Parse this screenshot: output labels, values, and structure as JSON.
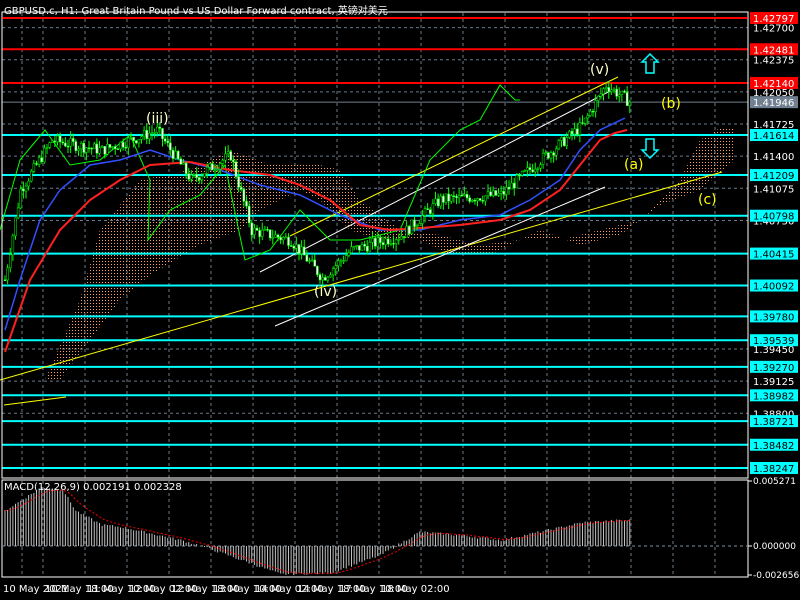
{
  "header": {
    "title": "GBPUSD.c, H1:  Great Britain Pound vs US Dollar Forward contract, 英镑对美元"
  },
  "colors": {
    "background": "#000000",
    "bull": "#00ff00",
    "red_level": "#ff0000",
    "cyan_level": "#00ffff",
    "current_price": "#708090",
    "wave_label": "#ffff00"
  },
  "chart_data": {
    "type": "candlestick",
    "symbol": "GBPUSD.c",
    "timeframe": "H1",
    "ylim": [
      1.381,
      1.429
    ],
    "current_price": "1.41946",
    "y_ticks": [
      "1.42700",
      "1.42375",
      "1.42050",
      "1.41725",
      "1.41400",
      "1.41075",
      "1.40750",
      "1.39450",
      "1.39125",
      "1.38800"
    ],
    "x_ticks": [
      "10 May 2021",
      "10 May 18:00",
      "11 May 10:00",
      "12 May 02:00",
      "12 May 18:00",
      "13 May 10:00",
      "14 May 02:00",
      "14 May 18:00",
      "17 May 10:00",
      "18 May 02:00"
    ],
    "red_levels": [
      "1.42797",
      "1.42481",
      "1.42140"
    ],
    "cyan_levels": [
      "1.41614",
      "1.41209",
      "1.40798",
      "1.40415",
      "1.40092",
      "1.39780",
      "1.39539",
      "1.39270",
      "1.38982",
      "1.38721",
      "1.38482",
      "1.38247"
    ],
    "price_path": [
      [
        0,
        1.4015
      ],
      [
        6,
        1.4106
      ],
      [
        18,
        1.4156
      ],
      [
        37,
        1.4146
      ],
      [
        58,
        1.4166
      ],
      [
        71,
        1.4116
      ],
      [
        86,
        1.4141
      ],
      [
        94,
        1.4065
      ],
      [
        109,
        1.4055
      ],
      [
        121,
        1.4017
      ],
      [
        132,
        1.4045
      ],
      [
        151,
        1.406
      ],
      [
        166,
        1.4096
      ],
      [
        189,
        1.4101
      ],
      [
        204,
        1.4136
      ],
      [
        220,
        1.4171
      ],
      [
        229,
        1.4212
      ],
      [
        238,
        1.4195
      ]
    ],
    "wave_labels": [
      "(iii)",
      "(iv)",
      "(v)",
      "(a)",
      "(b)",
      "(c)"
    ],
    "macd": {
      "label": "MACD(12,26,9) 0.002191 0.002328",
      "y_ticks": [
        "0.005271",
        "0.000000",
        "-0.002656"
      ],
      "ylim": [
        -0.002656,
        0.005271
      ],
      "histogram_path": [
        [
          0,
          0.003
        ],
        [
          14,
          0.005
        ],
        [
          22,
          0.0048
        ],
        [
          27,
          0.003
        ],
        [
          37,
          0.0018
        ],
        [
          45,
          0.0016
        ],
        [
          67,
          0.0005
        ],
        [
          75,
          0.0
        ],
        [
          94,
          -0.0015
        ],
        [
          105,
          -0.0024
        ],
        [
          124,
          -0.0023
        ],
        [
          143,
          -0.0008
        ],
        [
          158,
          0.0012
        ],
        [
          174,
          0.0009
        ],
        [
          189,
          0.0005
        ],
        [
          204,
          0.0012
        ],
        [
          220,
          0.002
        ],
        [
          236,
          0.0022
        ]
      ]
    }
  }
}
